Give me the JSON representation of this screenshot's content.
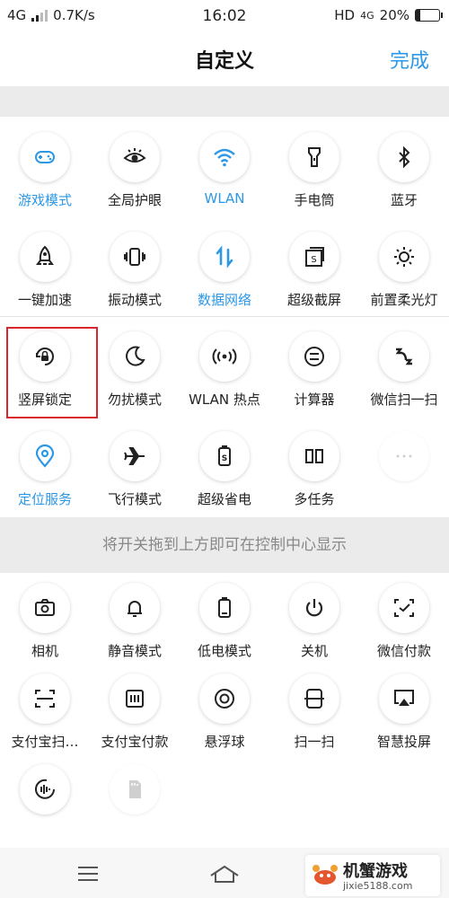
{
  "status_bar": {
    "network": "4G",
    "speed": "0.7K/s",
    "time": "16:02",
    "hd": "HD",
    "net_right": "4G",
    "battery": "20%",
    "battery_level": 0.2
  },
  "header": {
    "title": "自定义",
    "done": "完成"
  },
  "active_tiles": [
    {
      "label": "游戏模式",
      "icon": "gamepad-icon",
      "on": true
    },
    {
      "label": "全局护眼",
      "icon": "eye-icon",
      "on": false
    },
    {
      "label": "WLAN",
      "icon": "wifi-icon",
      "on": true
    },
    {
      "label": "手电筒",
      "icon": "flashlight-icon",
      "on": false
    },
    {
      "label": "蓝牙",
      "icon": "bluetooth-icon",
      "on": false
    },
    {
      "label": "一键加速",
      "icon": "rocket-icon",
      "on": false
    },
    {
      "label": "振动模式",
      "icon": "vibrate-icon",
      "on": false
    },
    {
      "label": "数据网络",
      "icon": "mobile-data-icon",
      "on": true
    },
    {
      "label": "超级截屏",
      "icon": "screenshot-icon",
      "on": false
    },
    {
      "label": "前置柔光灯",
      "icon": "brightness-icon",
      "on": false
    },
    {
      "label": "竖屏锁定",
      "icon": "rotation-lock-icon",
      "on": false
    },
    {
      "label": "勿扰模式",
      "icon": "moon-icon",
      "on": false
    },
    {
      "label": "WLAN 热点",
      "icon": "hotspot-icon",
      "on": false
    },
    {
      "label": "计算器",
      "icon": "calculator-icon",
      "on": false
    },
    {
      "label": "微信扫一扫",
      "icon": "wechat-scan-icon",
      "on": false
    },
    {
      "label": "定位服务",
      "icon": "location-icon",
      "on": true
    },
    {
      "label": "飞行模式",
      "icon": "airplane-icon",
      "on": false
    },
    {
      "label": "超级省电",
      "icon": "battery-saver-icon",
      "on": false
    },
    {
      "label": "多任务",
      "icon": "multitask-icon",
      "on": false
    },
    {
      "label": "",
      "icon": "more-icon",
      "on": false
    }
  ],
  "hint": "将开关拖到上方即可在控制中心显示",
  "more_tiles": [
    {
      "label": "相机",
      "icon": "camera-icon"
    },
    {
      "label": "静音模式",
      "icon": "bell-icon"
    },
    {
      "label": "低电模式",
      "icon": "low-battery-icon"
    },
    {
      "label": "关机",
      "icon": "power-icon"
    },
    {
      "label": "微信付款",
      "icon": "wechat-pay-icon"
    },
    {
      "label": "支付宝扫…",
      "icon": "alipay-scan-icon"
    },
    {
      "label": "支付宝付款",
      "icon": "alipay-pay-icon"
    },
    {
      "label": "悬浮球",
      "icon": "float-ball-icon"
    },
    {
      "label": "扫一扫",
      "icon": "scan-icon"
    },
    {
      "label": "智慧投屏",
      "icon": "cast-icon"
    },
    {
      "label": "",
      "icon": "voice-icon"
    },
    {
      "label": "",
      "icon": "sd-card-icon"
    }
  ],
  "watermark": {
    "name": "机蟹游戏",
    "url": "jixie5188.com"
  },
  "colors": {
    "accent": "#2c98e6",
    "highlight": "#d9262c"
  }
}
